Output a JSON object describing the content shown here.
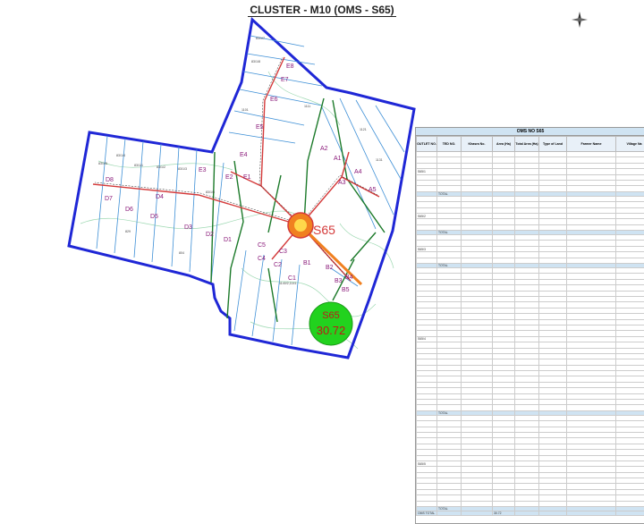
{
  "title": "CLUSTER - M10 (OMS - S65)",
  "substation": {
    "label": "S65",
    "capacity_label": "S65",
    "capacity_value": "30.72"
  },
  "feeder_labels": [
    "A1",
    "A2",
    "A3",
    "A4",
    "A5",
    "B1",
    "B2",
    "B3",
    "B4",
    "B5",
    "C1",
    "C2",
    "C3",
    "C4",
    "C5",
    "D1",
    "D2",
    "D3",
    "D4",
    "D5",
    "D6",
    "D7",
    "D8",
    "E1",
    "E2",
    "E3",
    "E4",
    "E5",
    "E6",
    "E7",
    "E8"
  ],
  "plot_labels": [
    "83/1/1",
    "83/1/2",
    "83/1/3",
    "83/1/4",
    "83/1/5",
    "83/1/6",
    "83/1/7",
    "83/1/8",
    "1121",
    "1111",
    "1101",
    "1131",
    "1140/2,1141",
    "829",
    "804"
  ],
  "table": {
    "caption": "OMS NO S65",
    "headers": [
      "OUTLET NO.",
      "TED NO.",
      "Khasra No.",
      "Area (Ha)",
      "Total Area (Ha)",
      "Type of Land",
      "Farmer Name",
      "Village Na"
    ],
    "group_labels": [
      "S65/1",
      "S65/2",
      "S65/3",
      "S65/4",
      "S65/5"
    ],
    "total_label": "TOTAL",
    "grand_total_label": "OMS TOTAL",
    "grand_total_value": "30.72"
  },
  "colors": {
    "boundary": "#1f27d6",
    "feeder": "#d43a3a",
    "plot_green": "#1c7a2a",
    "plot_line": "#3d8fd6",
    "substation": "#f08020",
    "capacity_badge": "#22d21e"
  }
}
